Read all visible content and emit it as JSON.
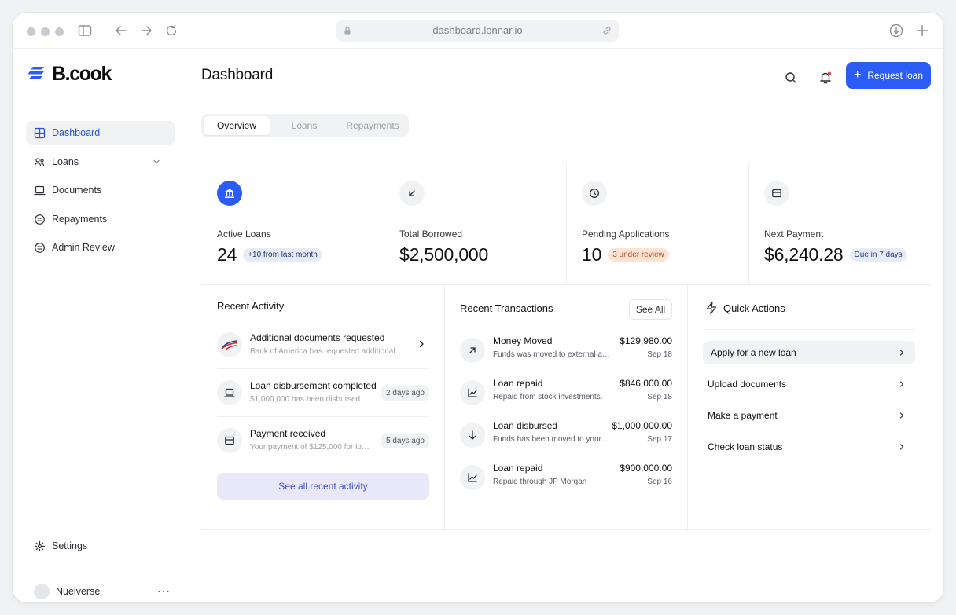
{
  "browser": {
    "url": "dashboard.lonnar.io"
  },
  "brand": {
    "name": "B.cook"
  },
  "sidebar": {
    "items": [
      {
        "label": "Dashboard",
        "icon": "grid-icon"
      },
      {
        "label": "Loans",
        "icon": "people-icon"
      },
      {
        "label": "Documents",
        "icon": "laptop-icon"
      },
      {
        "label": "Repayments",
        "icon": "coin-icon"
      },
      {
        "label": "Admin Review",
        "icon": "coin-icon"
      }
    ],
    "settings_label": "Settings",
    "user_name": "Nuelverse"
  },
  "header": {
    "title": "Dashboard",
    "request_button": "Request loan"
  },
  "tabs": [
    "Overview",
    "Loans",
    "Repayments"
  ],
  "stats": [
    {
      "label": "Active Loans",
      "value": "24",
      "badge": "+10 from last month"
    },
    {
      "label": "Total Borrowed",
      "value": "$2,500,000"
    },
    {
      "label": "Pending Applications",
      "value": "10",
      "badge": "3 under review"
    },
    {
      "label": "Next Payment",
      "value": "$6,240.28",
      "badge": "Due in 7 days"
    }
  ],
  "recent_activity": {
    "title": "Recent Activity",
    "items": [
      {
        "title": "Additional documents requested",
        "subtitle": "Bank of America has requested additional fin..."
      },
      {
        "title": "Loan disbursement completed",
        "subtitle": "$1,000,000 has been disbursed to...",
        "time": "2 days ago"
      },
      {
        "title": "Payment received",
        "subtitle": "Your payment of $125,000 for loan...",
        "time": "5 days ago"
      }
    ],
    "see_all": "See all recent activity"
  },
  "recent_transactions": {
    "title": "Recent Transactions",
    "see_all": "See All",
    "items": [
      {
        "title": "Money Moved",
        "subtitle": "Funds was moved to external acc...",
        "amount": "$129,980.00",
        "date": "Sep 18"
      },
      {
        "title": "Loan repaid",
        "subtitle": "Repaid from stock investments.",
        "amount": "$846,000.00",
        "date": "Sep 18"
      },
      {
        "title": "Loan disbursed",
        "subtitle": "Funds has been moved to your...",
        "amount": "$1,000,000.00",
        "date": "Sep 17"
      },
      {
        "title": "Loan repaid",
        "subtitle": "Repaid through JP Morgan",
        "amount": "$900,000.00",
        "date": "Sep 16"
      }
    ]
  },
  "quick_actions": {
    "title": "Quick Actions",
    "items": [
      "Apply for a new loan",
      "Upload documents",
      "Make a payment",
      "Check loan status"
    ]
  },
  "colors": {
    "accent": "#2b5cf6",
    "notification_dot": "#e5484d",
    "orange_badge_bg": "#fde3d3",
    "see_recent_bg": "#e9e8fb"
  }
}
